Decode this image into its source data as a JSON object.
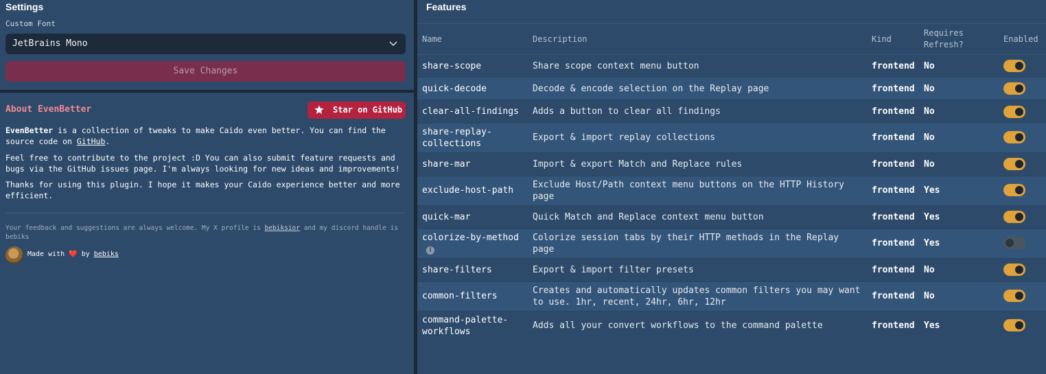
{
  "settings": {
    "title": "Settings",
    "font_label": "Custom Font",
    "font_value": "JetBrains Mono",
    "save_label": "Save Changes"
  },
  "about": {
    "title": "About EvenBetter",
    "star_label": "Star on GitHub",
    "p1_name": "EvenBetter",
    "p1_text": " is a collection of tweaks to make Caido even better. You can find the source code on ",
    "p1_link": "GitHub",
    "p1_end": ".",
    "p2": "Feel free to contribute to the project :D You can also submit feature requests and bugs via the GitHub issues page. I'm always looking for new ideas and improvements!",
    "p3": "Thanks for using this plugin. I hope it makes your Caido experience better and more efficient.",
    "feedback_pre": "Your feedback and suggestions are always welcome. My X profile is ",
    "feedback_x": "bebiksior",
    "feedback_mid": " and my discord handle is bebiks",
    "made_with": "Made with",
    "heart": "❤️",
    "by": "by",
    "author": "bebiks"
  },
  "features": {
    "title": "Features",
    "headers": {
      "name": "Name",
      "description": "Description",
      "kind": "Kind",
      "refresh_1": "Requires",
      "refresh_2": "Refresh?",
      "enabled": "Enabled"
    },
    "rows": [
      {
        "name": "share-scope",
        "description": "Share scope context menu button",
        "kind": "frontend",
        "refresh": "No",
        "enabled": true
      },
      {
        "name": "quick-decode",
        "description": "Decode & encode selection on the Replay page",
        "kind": "frontend",
        "refresh": "No",
        "enabled": true
      },
      {
        "name": "clear-all-findings",
        "description": "Adds a button to clear all findings",
        "kind": "frontend",
        "refresh": "No",
        "enabled": true
      },
      {
        "name": "share-replay-collections",
        "name_1": "share-replay-",
        "name_2": "collections",
        "description": "Export & import replay collections",
        "kind": "frontend",
        "refresh": "No",
        "enabled": true
      },
      {
        "name": "share-mar",
        "description": "Import & export Match and Replace rules",
        "kind": "frontend",
        "refresh": "No",
        "enabled": true
      },
      {
        "name": "exclude-host-path",
        "description_1": "Exclude Host/Path context menu buttons on the HTTP History",
        "description_2": "page",
        "kind": "frontend",
        "refresh": "Yes",
        "enabled": true
      },
      {
        "name": "quick-mar",
        "description": "Quick Match and Replace context menu button",
        "kind": "frontend",
        "refresh": "Yes",
        "enabled": true
      },
      {
        "name": "colorize-by-method",
        "info": "i",
        "description_1": "Colorize session tabs by their HTTP methods in the Replay",
        "description_2": "page",
        "kind": "frontend",
        "refresh": "Yes",
        "enabled": false
      },
      {
        "name": "share-filters",
        "description": "Export & import filter presets",
        "kind": "frontend",
        "refresh": "No",
        "enabled": true
      },
      {
        "name": "common-filters",
        "description_1": "Creates and automatically updates common filters you may want",
        "description_2": "to use. 1hr, recent, 24hr, 6hr, 12hr",
        "kind": "frontend",
        "refresh": "No",
        "enabled": true
      },
      {
        "name": "command-palette-workflows",
        "name_1": "command-palette-",
        "name_2": "workflows",
        "description": "Adds all your convert workflows to the command palette",
        "kind": "frontend",
        "refresh": "Yes",
        "enabled": true
      }
    ]
  },
  "colors": {
    "panel": "#2d4a6a",
    "row_alt": "#34557a",
    "accent": "#e0a23a",
    "save": "#7a2e4e",
    "star": "#b3223f",
    "about_title": "#f08a94"
  }
}
